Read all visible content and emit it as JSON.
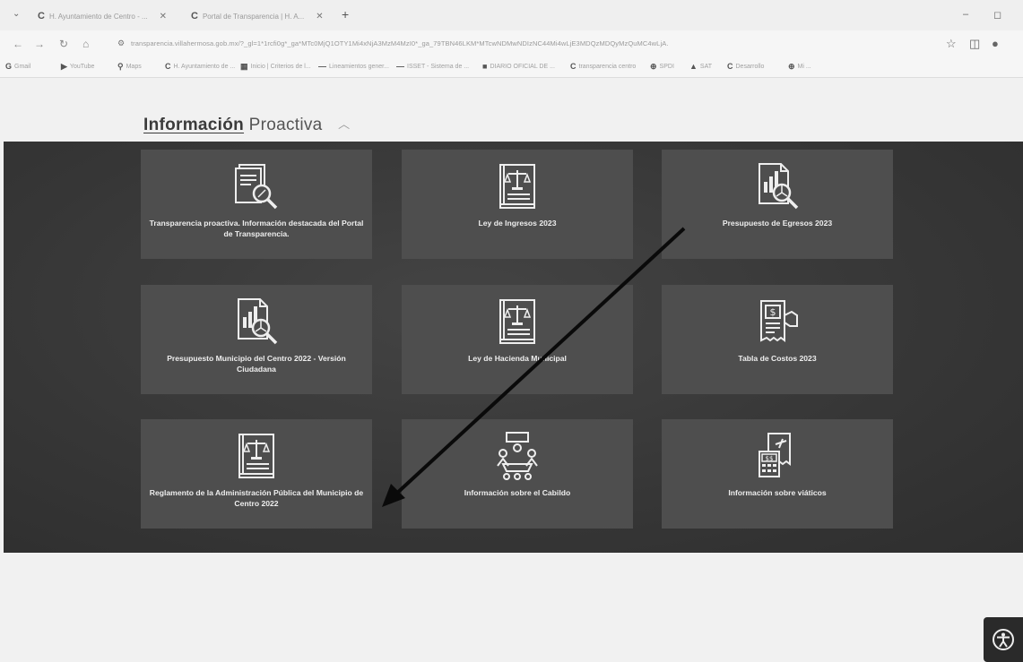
{
  "browser": {
    "tabs": [
      {
        "title": "H. Ayuntamiento de Centro - ...",
        "favicon": "C"
      },
      {
        "title": "Portal de Transparencia | H. A...",
        "favicon": "C"
      }
    ],
    "url": "transparencia.villahermosa.gob.mx/?_gl=1*1rcfi0g*_ga*MTc0MjQ1OTY1Mi4xNjA3MzM4MzI0*_ga_79TBN46LKM*MTcwNDMwNDIzNC44Mi4wLjE3MDQzMDQyMzQuMC4wLjA.",
    "bookmarks": [
      {
        "icon": "G",
        "label": "Gmail"
      },
      {
        "icon": "▶",
        "label": "YouTube"
      },
      {
        "icon": "⚲",
        "label": "Maps"
      },
      {
        "icon": "C",
        "label": "H. Ayuntamiento de ..."
      },
      {
        "icon": "▦",
        "label": "Inicio | Criterios de l..."
      },
      {
        "icon": "—",
        "label": "Lineamientos gener..."
      },
      {
        "icon": "—",
        "label": "ISSET - Sistema de ..."
      },
      {
        "icon": "■",
        "label": "DIARIO OFICIAL DE ..."
      },
      {
        "icon": "C",
        "label": "transparencia centro"
      },
      {
        "icon": "⊕",
        "label": "SPDI"
      },
      {
        "icon": "▲",
        "label": "SAT"
      },
      {
        "icon": "C",
        "label": "Desarrollo"
      },
      {
        "icon": "⊕",
        "label": "Mi ..."
      }
    ]
  },
  "section": {
    "title_strong": "Información",
    "title_rest": "Proactiva"
  },
  "cards": [
    {
      "label": "Transparencia proactiva. Información destacada del Portal de Transparencia.",
      "icon": "document-search-icon"
    },
    {
      "label": "Ley de Ingresos 2023",
      "icon": "law-book-icon"
    },
    {
      "label": "Presupuesto de Egresos 2023",
      "icon": "budget-report-icon"
    },
    {
      "label": "Presupuesto Municipio del Centro 2022 - Versión Ciudadana",
      "icon": "budget-report-icon"
    },
    {
      "label": "Ley de Hacienda Municipal",
      "icon": "law-book-icon"
    },
    {
      "label": "Tabla de Costos 2023",
      "icon": "receipt-payment-icon"
    },
    {
      "label": "Reglamento de la Administración Pública del Municipio de Centro 2022",
      "icon": "law-book-icon"
    },
    {
      "label": "Información sobre el Cabildo",
      "icon": "council-meeting-icon"
    },
    {
      "label": "Información sobre viáticos",
      "icon": "travel-expenses-icon"
    }
  ],
  "colors": {
    "card": "#4e4e4e",
    "background": "#3a3a3a",
    "text": "#eeeeee"
  }
}
